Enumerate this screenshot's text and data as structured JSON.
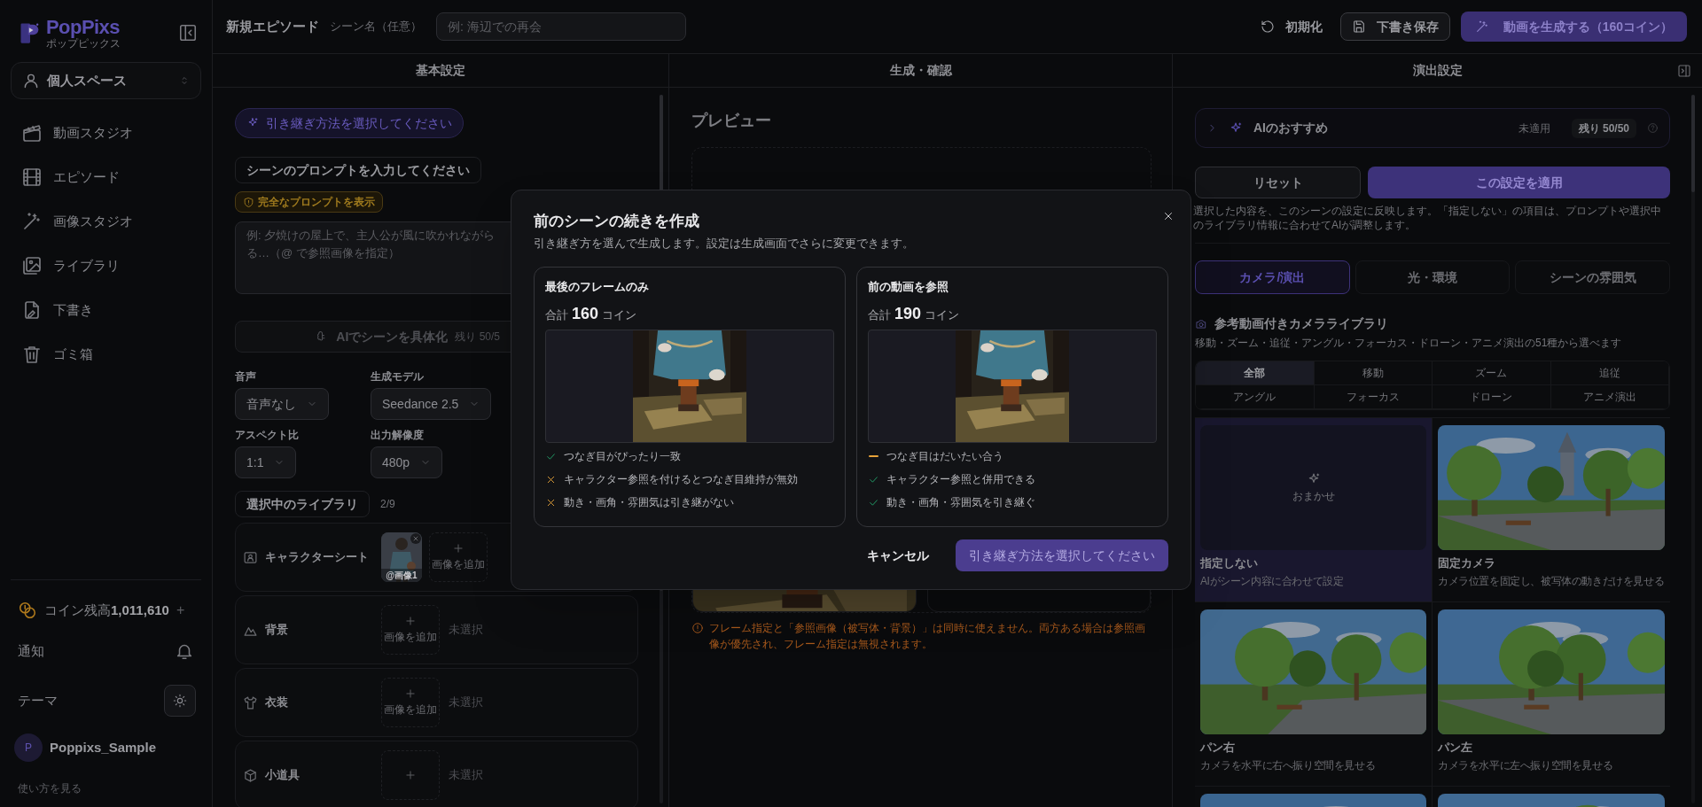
{
  "sidebar": {
    "logo": {
      "name": "PopPixs",
      "subtitle": "ポップピックス"
    },
    "workspace": "個人スペース",
    "nav": [
      {
        "label": "動画スタジオ"
      },
      {
        "label": "エピソード"
      },
      {
        "label": "画像スタジオ"
      },
      {
        "label": "ライブラリ"
      },
      {
        "label": "下書き"
      },
      {
        "label": "ゴミ箱"
      }
    ],
    "coins": {
      "label": "コイン残高",
      "amount": "1,011,610",
      "add": "+"
    },
    "notifications": "通知",
    "theme": "テーマ",
    "user": {
      "initial": "P",
      "name": "Poppixs_Sample"
    },
    "help": "使い方を見る"
  },
  "topbar": {
    "title": "新規エピソード",
    "scene_label": "シーン名（任意）",
    "scene_placeholder": "例: 海辺での再会",
    "reset": "初期化",
    "save": "下書き保存",
    "generate": "動画を生成する（160コイン）"
  },
  "columns": [
    "基本設定",
    "生成・確認",
    "演出設定"
  ],
  "basic": {
    "continuation": "引き継ぎ方法を選択してください",
    "prompt_label": "シーンのプロンプトを入力してください",
    "full_prompt": "完全なプロンプトを表示",
    "prompt_placeholder": [
      "例: 夕焼けの屋上で、主人公が風に吹かれながら",
      "る…（@ で参照画像を指定）"
    ],
    "ai_button": "AIでシーンを具体化",
    "ai_remaining": "残り 50/5",
    "settings": [
      {
        "label": "音声",
        "value": "音声なし"
      },
      {
        "label": "生成モデル",
        "value": "Seedance 2.5"
      },
      {
        "label": "アスペクト比",
        "value": "1:1"
      },
      {
        "label": "出力解像度",
        "value": "480p"
      }
    ],
    "library": {
      "title": "選択中のライブラリ",
      "count": "2/9",
      "rows": [
        {
          "label": "キャラクターシート",
          "images": [
            {
              "tag": "@画像1"
            }
          ],
          "add": "画像を追加"
        },
        {
          "label": "背景",
          "add": "画像を追加",
          "empty": "未選択"
        },
        {
          "label": "衣装",
          "add": "画像を追加",
          "empty": "未選択"
        },
        {
          "label": "小道具",
          "empty": "未選択"
        }
      ]
    }
  },
  "generate": {
    "preview_title": "プレビュー",
    "warning": "フレーム指定と「参照画像（被写体・背景）」は同時に使えません。両方ある場合は参照画像が優先され、フレーム指定は無視されます。"
  },
  "direction": {
    "ai": {
      "title": "AIのおすすめ",
      "status": "未適用",
      "remaining": "残り 50/50"
    },
    "reset": "リセット",
    "apply": "この設定を適用",
    "description": "選択した内容を、このシーンの設定に反映します。「指定しない」の項目は、プロンプトや選択中のライブラリ情報に合わせてAIが調整します。",
    "tabs": [
      {
        "label": "カメラ/演出",
        "selected": true
      },
      {
        "label": "光・環境",
        "selected": false
      },
      {
        "label": "シーンの雰囲気",
        "selected": false
      }
    ],
    "library_title": "参考動画付きカメラライブラリ",
    "library_subtitle": "移動・ズーム・追従・アングル・フォーカス・ドローン・アニメ演出の51種から選べます",
    "filters": [
      {
        "label": "全部",
        "selected": true
      },
      {
        "label": "移動",
        "selected": false
      },
      {
        "label": "ズーム",
        "selected": false
      },
      {
        "label": "追従",
        "selected": false
      },
      {
        "label": "アングル",
        "selected": false
      },
      {
        "label": "フォーカス",
        "selected": false
      },
      {
        "label": "ドローン",
        "selected": false
      },
      {
        "label": "アニメ演出",
        "selected": false
      }
    ],
    "cards": [
      {
        "kind": "auto",
        "auto_label": "おまかせ",
        "title": "指定しない",
        "desc": "AIがシーン内容に合わせて設定",
        "selected": true
      },
      {
        "kind": "picture",
        "title": "固定カメラ",
        "desc": "カメラ位置を固定し、被写体の動きだけを見せる",
        "selected": false
      },
      {
        "kind": "picture",
        "title": "パン右",
        "desc": "カメラを水平に右へ振り空間を見せる",
        "selected": false
      },
      {
        "kind": "picture",
        "title": "パン左",
        "desc": "カメラを水平に左へ振り空間を見せる",
        "selected": false
      },
      {
        "kind": "picture",
        "selected": false
      },
      {
        "kind": "picture",
        "selected": false
      }
    ]
  },
  "modal": {
    "title": "前のシーンの続きを作成",
    "subtitle": "引き継ぎ方を選んで生成します。設定は生成画面でさらに変更できます。",
    "options": [
      {
        "title": "最後のフレームのみ",
        "total_label": "合計",
        "cost": "160",
        "unit": "コイン",
        "selected": false,
        "points": [
          {
            "kind": "good",
            "text": "つなぎ目がぴったり一致"
          },
          {
            "kind": "bad",
            "text": "キャラクター参照を付けるとつなぎ目維持が無効"
          },
          {
            "kind": "bad",
            "text": "動き・画角・雰囲気は引き継がない"
          }
        ]
      },
      {
        "title": "前の動画を参照",
        "total_label": "合計",
        "cost": "190",
        "unit": "コイン",
        "selected": false,
        "points": [
          {
            "kind": "partial",
            "text": "つなぎ目はだいたい合う"
          },
          {
            "kind": "good",
            "text": "キャラクター参照と併用できる"
          },
          {
            "kind": "good",
            "text": "動き・画角・雰囲気を引き継ぐ"
          }
        ]
      }
    ],
    "cancel": "キャンセル",
    "confirm": "引き継ぎ方法を選択してください"
  }
}
